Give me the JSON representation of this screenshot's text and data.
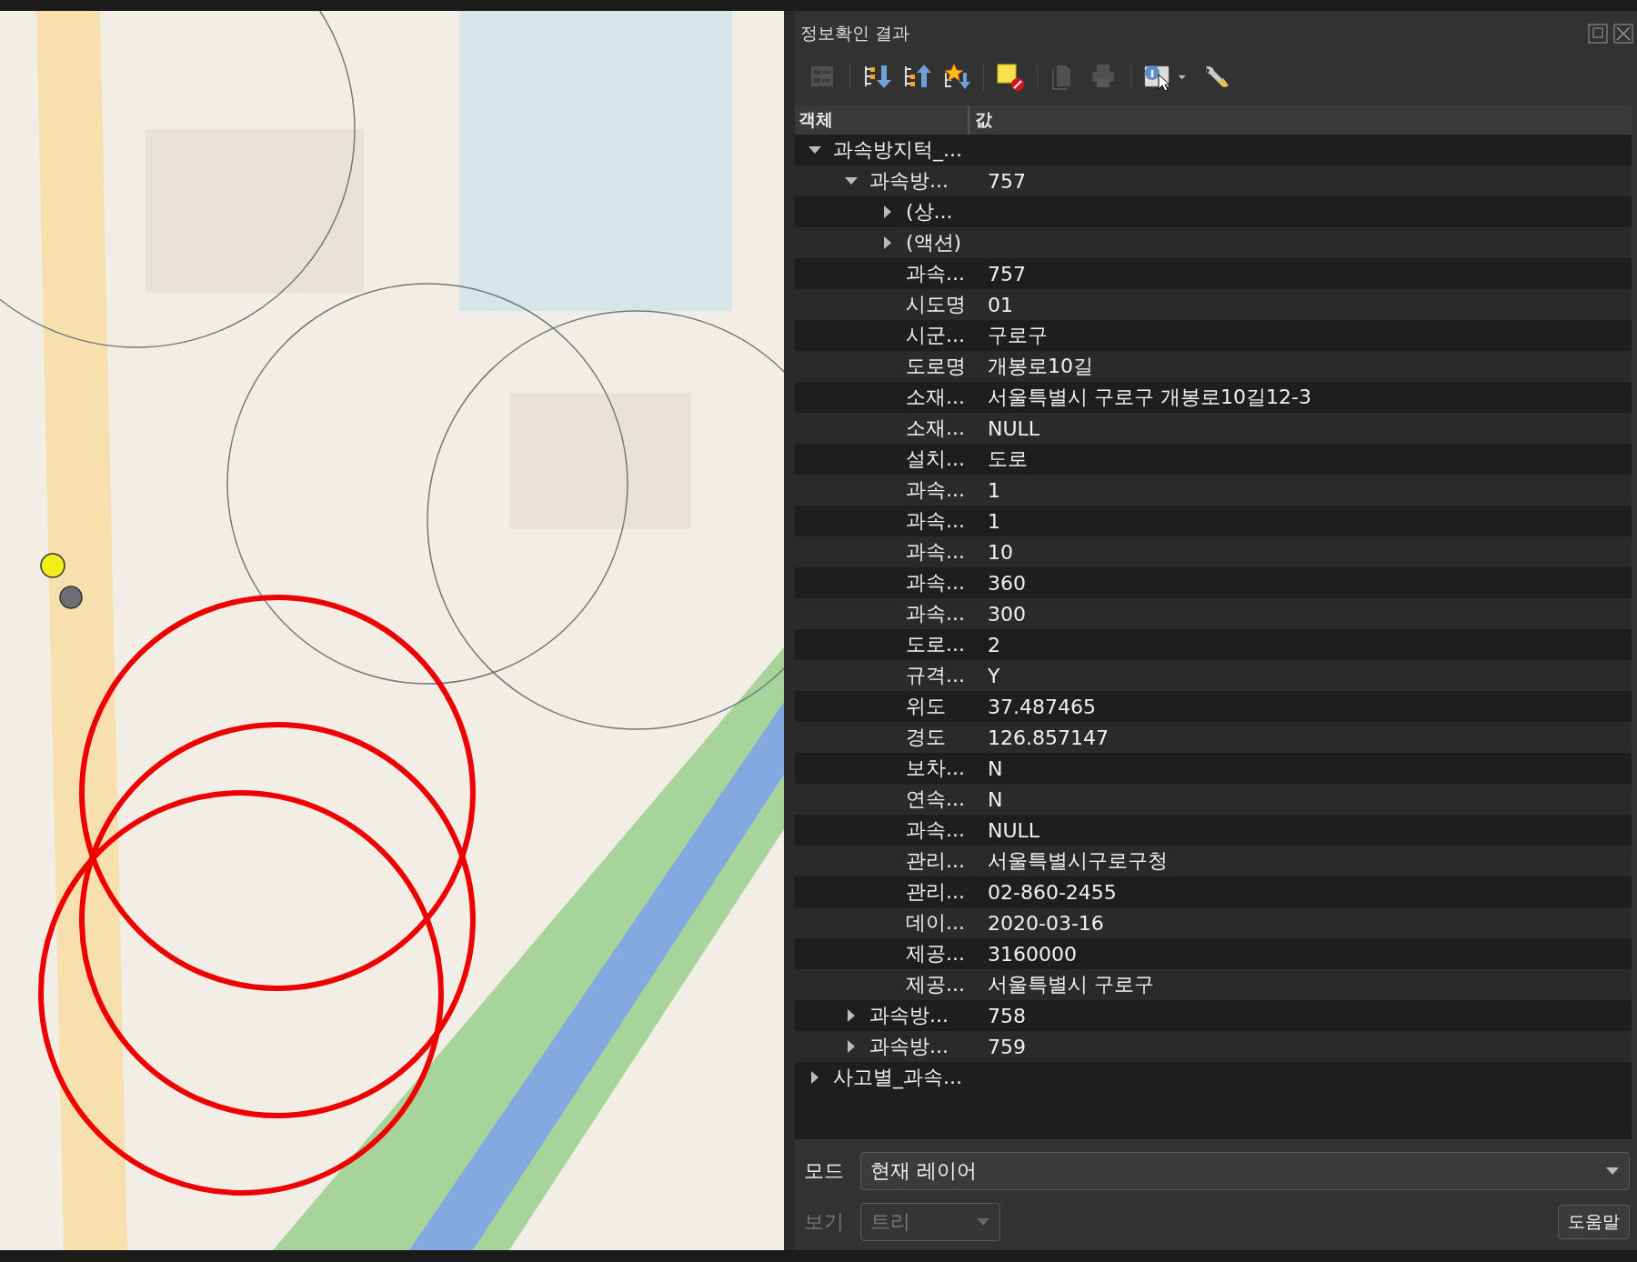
{
  "map": {
    "kind": "picture"
  },
  "panel": {
    "title": "정보확인 결과"
  },
  "toolbar": [
    {
      "kind": "form",
      "disabled": true
    },
    {
      "kind": "sep"
    },
    {
      "kind": "expand"
    },
    {
      "kind": "collapse"
    },
    {
      "kind": "star"
    },
    {
      "kind": "sep"
    },
    {
      "kind": "clear"
    },
    {
      "kind": "sep"
    },
    {
      "kind": "copy",
      "disabled": true
    },
    {
      "kind": "print",
      "disabled": true
    },
    {
      "kind": "sep"
    },
    {
      "kind": "identify"
    },
    {
      "kind": "caret"
    },
    {
      "kind": "wrench"
    }
  ],
  "columns": [
    "객체",
    "값"
  ],
  "tree": [
    {
      "kind": "branch",
      "label": "과속방지턱_...",
      "expanded": true,
      "children": [
        {
          "kind": "branch",
          "label": "과속방...",
          "value": "757",
          "expanded": true,
          "children": [
            {
              "kind": "branch",
              "label": "(상...",
              "expanded": false
            },
            {
              "kind": "branch",
              "label": "(액션)",
              "expanded": false
            },
            {
              "kind": "leaf",
              "label": "과속...",
              "value": "757"
            },
            {
              "kind": "leaf",
              "label": "시도명",
              "value": "01"
            },
            {
              "kind": "leaf",
              "label": "시군...",
              "value": "구로구"
            },
            {
              "kind": "leaf",
              "label": "도로명",
              "value": "개봉로10길"
            },
            {
              "kind": "leaf",
              "label": "소재...",
              "value": "서울특별시 구로구 개봉로10길12-3"
            },
            {
              "kind": "leaf",
              "label": "소재...",
              "value": "NULL"
            },
            {
              "kind": "leaf",
              "label": "설치...",
              "value": "도로"
            },
            {
              "kind": "leaf",
              "label": "과속...",
              "value": "1"
            },
            {
              "kind": "leaf",
              "label": "과속...",
              "value": "1"
            },
            {
              "kind": "leaf",
              "label": "과속...",
              "value": "10"
            },
            {
              "kind": "leaf",
              "label": "과속...",
              "value": "360"
            },
            {
              "kind": "leaf",
              "label": "과속...",
              "value": "300"
            },
            {
              "kind": "leaf",
              "label": "도로...",
              "value": "2"
            },
            {
              "kind": "leaf",
              "label": "규격...",
              "value": "Y"
            },
            {
              "kind": "leaf",
              "label": "위도",
              "value": "37.487465"
            },
            {
              "kind": "leaf",
              "label": "경도",
              "value": "126.857147"
            },
            {
              "kind": "leaf",
              "label": "보차...",
              "value": "N"
            },
            {
              "kind": "leaf",
              "label": "연속...",
              "value": "N"
            },
            {
              "kind": "leaf",
              "label": "과속...",
              "value": "NULL"
            },
            {
              "kind": "leaf",
              "label": "관리...",
              "value": "서울특별시구로구청"
            },
            {
              "kind": "leaf",
              "label": "관리...",
              "value": "02-860-2455"
            },
            {
              "kind": "leaf",
              "label": "데이...",
              "value": "2020-03-16"
            },
            {
              "kind": "leaf",
              "label": "제공...",
              "value": "3160000"
            },
            {
              "kind": "leaf",
              "label": "제공...",
              "value": "서울특별시 구로구"
            }
          ]
        },
        {
          "kind": "branch",
          "label": "과속방...",
          "value": "758",
          "expanded": false
        },
        {
          "kind": "branch",
          "label": "과속방...",
          "value": "759",
          "expanded": false
        }
      ]
    },
    {
      "kind": "branch",
      "label": "사고별_과속...",
      "expanded": false
    }
  ],
  "mode": {
    "label": "모드",
    "value": "현재 레이어",
    "disabled": false
  },
  "view": {
    "label": "보기",
    "value": "트리",
    "disabled": true
  },
  "help_button": "도움말"
}
